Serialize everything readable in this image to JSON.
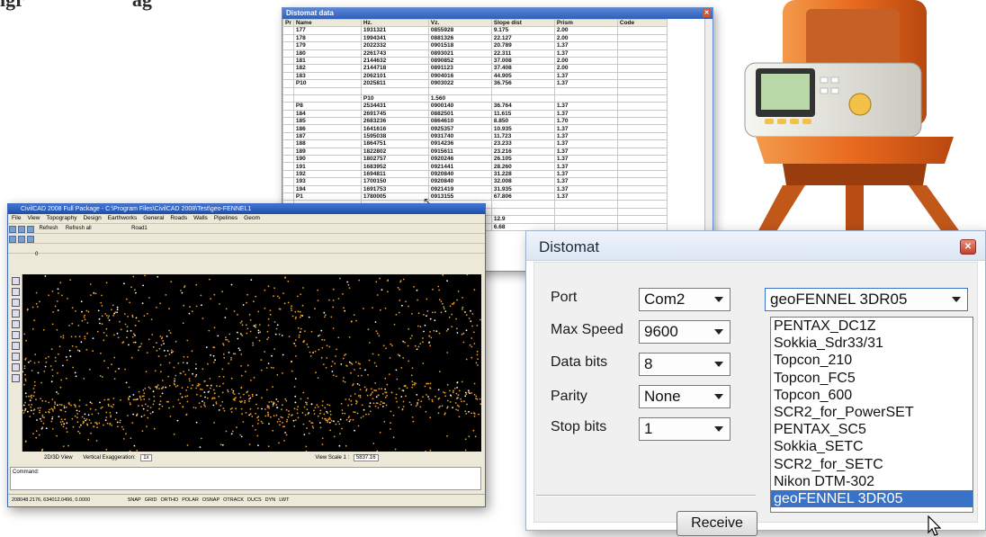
{
  "caption": {
    "left": "igr",
    "right": "ag"
  },
  "distomat_data": {
    "title": "Distomat data",
    "columns": [
      "Pr",
      "Name",
      "Hz.",
      "Vz.",
      "Slope dist",
      "Prism",
      "Code"
    ],
    "rows": [
      [
        "177",
        "1931321",
        "0855928",
        "9.175",
        "2.00"
      ],
      [
        "178",
        "1994341",
        "0881326",
        "22.127",
        "2.00"
      ],
      [
        "179",
        "2022332",
        "0901518",
        "20.789",
        "1.37"
      ],
      [
        "180",
        "2261743",
        "0893021",
        "22.311",
        "1.37"
      ],
      [
        "181",
        "2144632",
        "0890852",
        "37.008",
        "2.00"
      ],
      [
        "182",
        "2144718",
        "0891123",
        "37.408",
        "2.00"
      ],
      [
        "183",
        "2062101",
        "0904016",
        "44.905",
        "1.37"
      ],
      [
        "P10",
        "2025811",
        "0903022",
        "36.756",
        "1.37"
      ],
      [
        "",
        "",
        "",
        "",
        ""
      ],
      [
        "",
        "P10",
        "1.560",
        "",
        ""
      ],
      [
        "P8",
        "2534431",
        "0900140",
        "36.764",
        "1.37"
      ],
      [
        "184",
        "2691745",
        "0882501",
        "11.615",
        "1.37"
      ],
      [
        "185",
        "2683236",
        "0864610",
        "8.850",
        "1.70"
      ],
      [
        "186",
        "1641616",
        "0925357",
        "10.935",
        "1.37"
      ],
      [
        "187",
        "1595038",
        "0931740",
        "11.723",
        "1.37"
      ],
      [
        "188",
        "1864751",
        "0914236",
        "23.233",
        "1.37"
      ],
      [
        "189",
        "1822802",
        "0915611",
        "23.216",
        "1.37"
      ],
      [
        "190",
        "1802757",
        "0920246",
        "26.105",
        "1.37"
      ],
      [
        "191",
        "1683952",
        "0921441",
        "28.260",
        "1.37"
      ],
      [
        "192",
        "1694811",
        "0920840",
        "31.228",
        "1.37"
      ],
      [
        "193",
        "1700150",
        "0920840",
        "32.008",
        "1.37"
      ],
      [
        "194",
        "1691753",
        "0921419",
        "31.935",
        "1.37"
      ],
      [
        "P1",
        "1780005",
        "0913155",
        "67.806",
        "1.37"
      ],
      [
        "",
        "",
        "",
        "",
        ""
      ],
      [
        "",
        "P11",
        "1.520",
        "",
        ""
      ],
      [
        "P5",
        "0005753",
        "0900358",
        "12.9",
        ""
      ],
      [
        "195",
        "0781558",
        "0911207",
        "6.68",
        ""
      ]
    ]
  },
  "civilcad": {
    "title": "CivilCAD 2008 Full Package - C:\\Program Files\\CivilCAD 2008\\Test\\geo-FENNEL1",
    "menu": [
      "File",
      "View",
      "Topography",
      "Design",
      "Earthworks",
      "General",
      "Roads",
      "Walls",
      "Pipelines",
      "Geom"
    ],
    "toolbar": {
      "refresh": "Refresh",
      "refresh_all": "Refresh all",
      "road": "Road1"
    },
    "layer": "0",
    "viewbar": {
      "view": "2D/3D View",
      "vertical": "Vertical Exaggeration:",
      "vert_value": "1x",
      "scale_label": "View Scale 1 :",
      "scale_value": "5837.16"
    },
    "command": "Command:",
    "status": {
      "coords": "208048.2176, 634012.0496, 0.0000",
      "modes": [
        "SNAP",
        "GRID",
        "ORTHO",
        "POLAR",
        "OSNAP",
        "OTRACK",
        "DUCS",
        "DYN",
        "LWT"
      ]
    }
  },
  "dialog": {
    "title": "Distomat",
    "fields": [
      {
        "label": "Port",
        "value": "Com2"
      },
      {
        "label": "Max Speed",
        "value": "9600"
      },
      {
        "label": "Data bits",
        "value": "8"
      },
      {
        "label": "Parity",
        "value": "None"
      },
      {
        "label": "Stop bits",
        "value": "1"
      }
    ],
    "instrument": {
      "selected": "geoFENNEL 3DR05",
      "options": [
        "PENTAX_DC1Z",
        "Sokkia_Sdr33/31",
        "Topcon_210",
        "Topcon_FC5",
        "Topcon_600",
        "SCR2_for_PowerSET",
        "PENTAX_SC5",
        "Sokkia_SETC",
        "SCR2_for_SETC",
        "Nikon DTM-302",
        "geoFENNEL 3DR05"
      ]
    },
    "receive_label": "Receive"
  },
  "colors": {
    "accent": "#3a72c8",
    "station_orange": "#e8691e",
    "title_blue": "#2f5fb8"
  }
}
